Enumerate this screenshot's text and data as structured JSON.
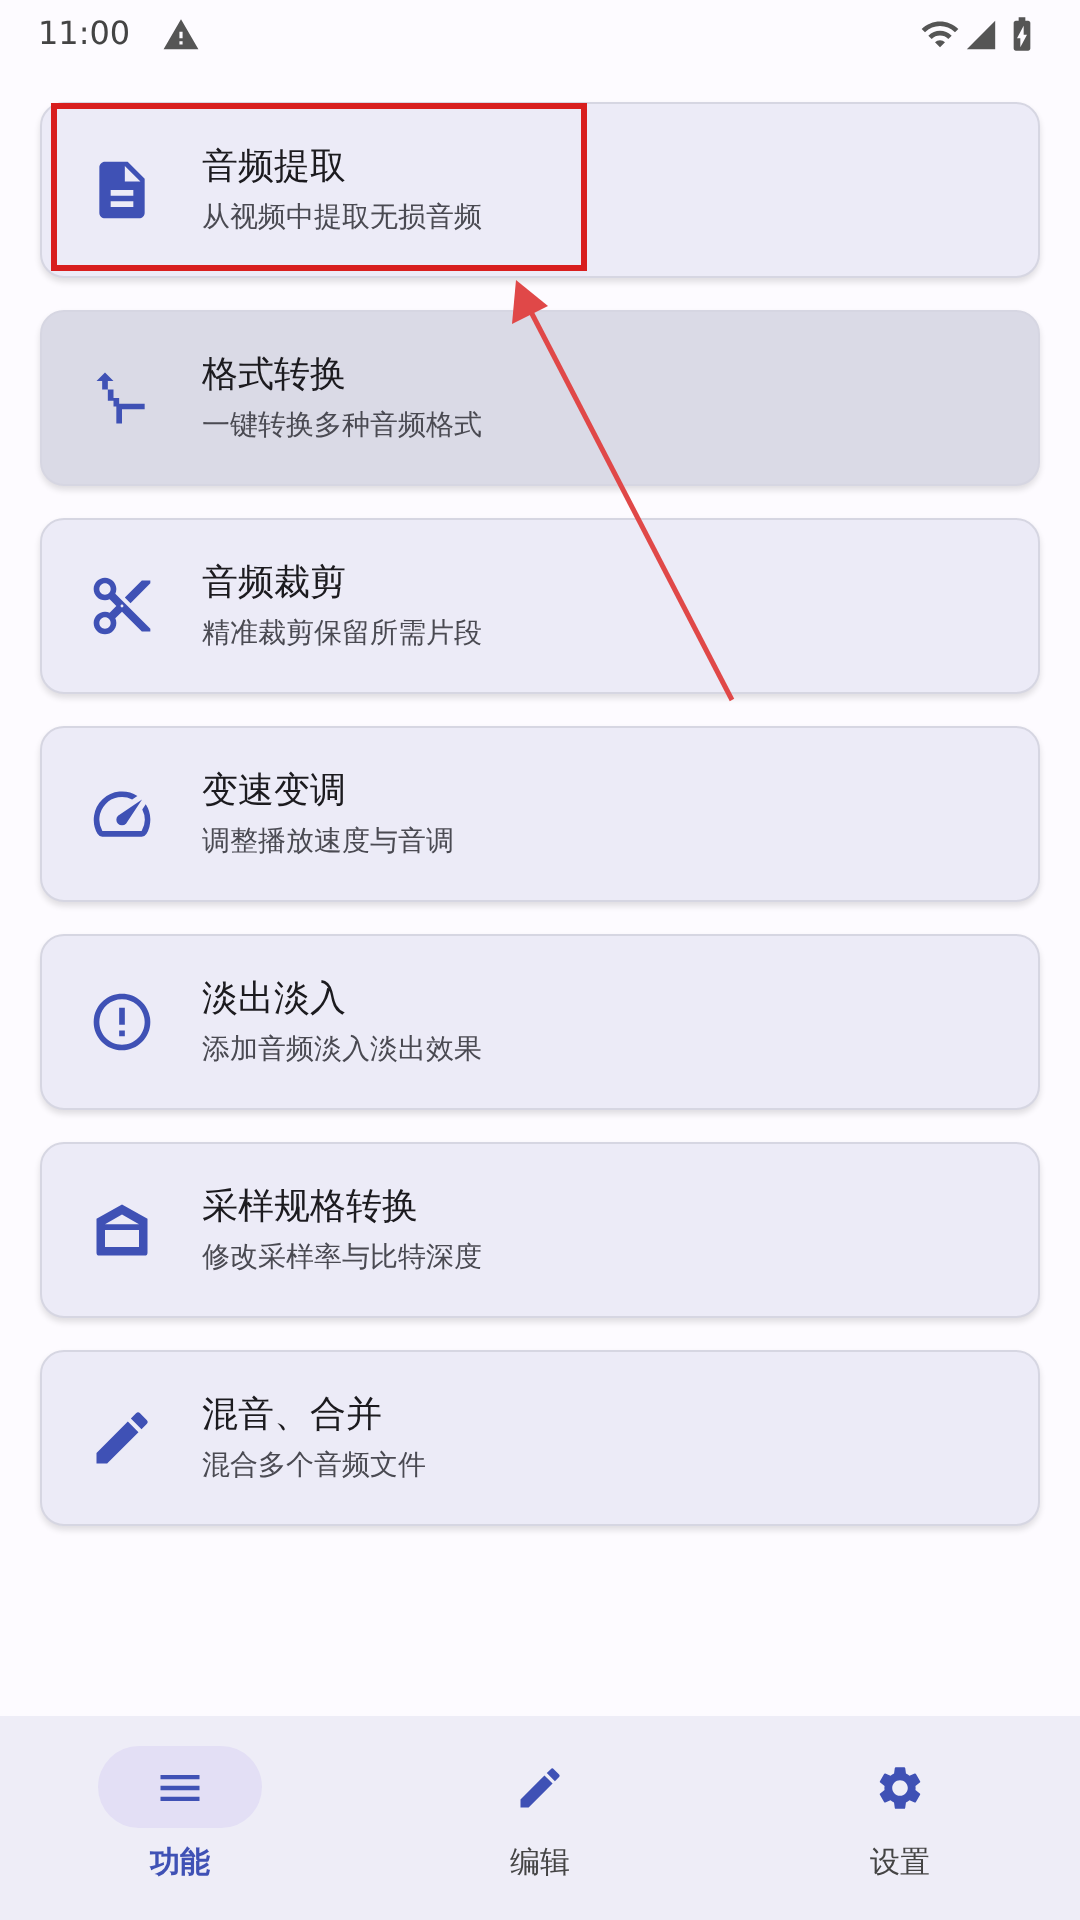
{
  "status_bar": {
    "time": "11:00"
  },
  "features": [
    {
      "title": "音频提取",
      "subtitle": "从视频中提取无损音频",
      "selected": false
    },
    {
      "title": "格式转换",
      "subtitle": "一键转换多种音频格式",
      "selected": true
    },
    {
      "title": "音频裁剪",
      "subtitle": "精准裁剪保留所需片段",
      "selected": false
    },
    {
      "title": "变速变调",
      "subtitle": "调整播放速度与音调",
      "selected": false
    },
    {
      "title": "淡出淡入",
      "subtitle": "添加音频淡入淡出效果",
      "selected": false
    },
    {
      "title": "采样规格转换",
      "subtitle": "修改采样率与比特深度",
      "selected": false
    },
    {
      "title": "混音、合并",
      "subtitle": "混合多个音频文件",
      "selected": false
    }
  ],
  "bottom_nav": [
    {
      "label": "功能",
      "selected": true
    },
    {
      "label": "编辑",
      "selected": false
    },
    {
      "label": "设置",
      "selected": false
    }
  ]
}
